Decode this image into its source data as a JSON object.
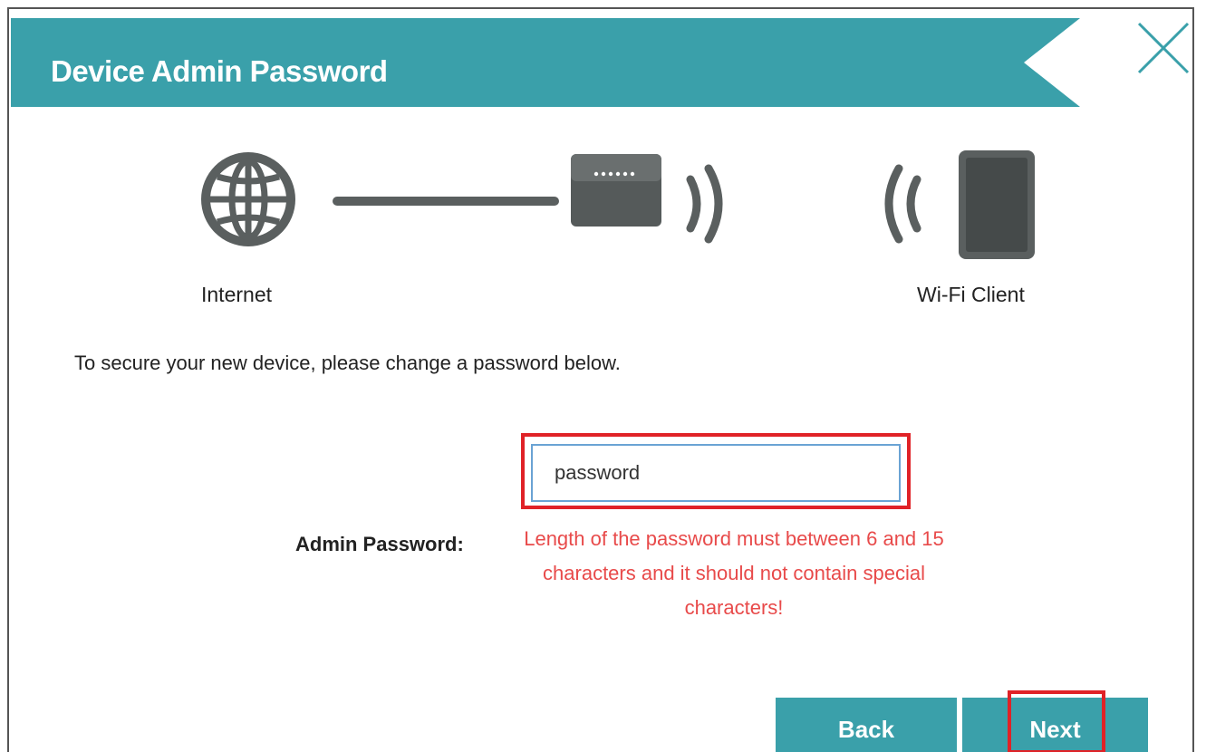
{
  "colors": {
    "accent": "#3aa0aa",
    "error": "#e84a4a",
    "highlight": "#e02227",
    "input_border": "#6aa3d4",
    "icon_gray": "#5a5f5f"
  },
  "header": {
    "title": "Device Admin Password",
    "close_icon": "close-icon"
  },
  "diagram": {
    "internet_label": "Internet",
    "client_label": "Wi-Fi Client",
    "icons": [
      "globe-icon",
      "cable-line",
      "router-icon",
      "wifi-signal-icon",
      "wifi-signal-icon",
      "tablet-icon"
    ]
  },
  "intro_text": "To secure your new device, please change a password below.",
  "form": {
    "password_label": "Admin Password:",
    "password_value": "password",
    "error_message": "Length of the password must between 6 and 15 characters and it should not contain special characters!"
  },
  "buttons": {
    "back_label": "Back",
    "next_label": "Next"
  }
}
